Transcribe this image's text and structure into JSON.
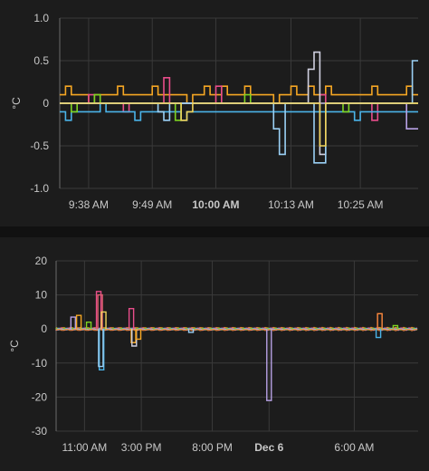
{
  "colors": {
    "background": "#1c1c1c",
    "grid": "#3a3a3a",
    "text": "#c8c8c8",
    "series": [
      "#f5a623",
      "#e84d8a",
      "#4ab3e8",
      "#7ed321",
      "#b8a2e6",
      "#ff8a3d",
      "#f0d35a",
      "#9ad0f5",
      "#d0d0e0",
      "#e06070"
    ]
  },
  "chart_data": [
    {
      "type": "line",
      "title": "",
      "xlabel": "",
      "ylabel": "°C",
      "ylim": [
        -1.0,
        1.0
      ],
      "yticks": [
        "1.0",
        "0.5",
        "0",
        "-0.5",
        "-1.0"
      ],
      "ytick_values": [
        1.0,
        0.5,
        0,
        -0.5,
        -1.0
      ],
      "xlim": [
        "9:33 AM",
        "10:35 AM"
      ],
      "xticks": [
        {
          "label": "9:38 AM",
          "t": 5,
          "bold": false
        },
        {
          "label": "9:49 AM",
          "t": 16,
          "bold": false
        },
        {
          "label": "10:00 AM",
          "t": 27,
          "bold": true
        },
        {
          "label": "10:13 AM",
          "t": 40,
          "bold": false
        },
        {
          "label": "10:25 AM",
          "t": 52,
          "bold": false
        }
      ],
      "x_span_minutes": 62,
      "grid": true,
      "series": [
        {
          "color": "#f5a623",
          "baseline": 0.1,
          "values": [
            0.1,
            0.2,
            0.1,
            0.1,
            0.1,
            0,
            0.1,
            0.1,
            0.1,
            0.1,
            0.2,
            0.1,
            0.1,
            0.1,
            0.1,
            0.1,
            0.2,
            0.1,
            0.1,
            0.1,
            0.1,
            0.1,
            0,
            0.1,
            0.1,
            0.2,
            0.1,
            0.1,
            0.2,
            0.1,
            0.1,
            0.1,
            0.2,
            0.1,
            0.1,
            0.1,
            0.1,
            0,
            0.1,
            0.1,
            0.2,
            0.1,
            0.1,
            0.2,
            0.1,
            0.1,
            0.2,
            0.1,
            0.1,
            0.1,
            0.1,
            0.1,
            0.1,
            0.1,
            0.2,
            0.1,
            0.1,
            0.1,
            0.1,
            0.1,
            0.2,
            0.1
          ]
        },
        {
          "color": "#e84d8a",
          "baseline": 0,
          "values": [
            0,
            0,
            0,
            0,
            0,
            0.1,
            0,
            0,
            0,
            0,
            0,
            -0.1,
            0,
            0,
            0,
            0,
            0,
            0,
            0.3,
            0,
            0,
            0,
            0,
            0,
            0,
            0,
            0,
            0.2,
            0,
            0,
            0,
            0,
            0,
            0,
            0,
            0,
            0,
            0,
            0,
            0,
            0,
            0,
            0,
            0,
            0,
            0.1,
            0,
            0,
            0,
            0,
            0,
            0,
            0,
            0,
            -0.2,
            0,
            0,
            0,
            0,
            0,
            0,
            0
          ]
        },
        {
          "color": "#4ab3e8",
          "baseline": -0.1,
          "values": [
            -0.1,
            -0.2,
            -0.1,
            -0.1,
            -0.1,
            -0.1,
            -0.1,
            0,
            -0.1,
            -0.1,
            -0.1,
            -0.1,
            -0.1,
            -0.2,
            -0.1,
            -0.1,
            -0.1,
            -0.1,
            -0.1,
            -0.1,
            -0.1,
            -0.2,
            -0.1,
            -0.1,
            -0.1,
            -0.1,
            -0.1,
            -0.1,
            -0.1,
            -0.1,
            -0.1,
            -0.1,
            -0.1,
            -0.1,
            -0.1,
            -0.1,
            -0.1,
            -0.1,
            -0.1,
            -0.1,
            -0.1,
            -0.1,
            -0.1,
            -0.1,
            -0.1,
            -0.1,
            -0.1,
            -0.1,
            -0.1,
            -0.1,
            -0.1,
            -0.2,
            -0.1,
            -0.1,
            -0.1,
            -0.1,
            -0.1,
            -0.1,
            -0.1,
            -0.1,
            -0.1,
            -0.1
          ]
        },
        {
          "color": "#7ed321",
          "baseline": 0,
          "values": [
            0,
            0,
            -0.1,
            0,
            0,
            0,
            0.1,
            0,
            0,
            0,
            0,
            0,
            0,
            0,
            0,
            0,
            0,
            0,
            0,
            0,
            -0.2,
            0,
            0,
            0,
            0,
            0,
            0,
            0,
            0,
            0,
            0,
            0,
            0.1,
            0,
            0,
            0,
            0,
            0,
            0,
            0,
            0,
            0,
            0,
            0,
            0,
            0,
            0,
            0,
            0,
            -0.1,
            0,
            0,
            0,
            0,
            0,
            0,
            0,
            0,
            0,
            0,
            0,
            0
          ]
        },
        {
          "color": "#d0d0e0",
          "baseline": 0,
          "values": [
            0,
            0,
            0,
            0,
            0,
            0,
            0,
            0,
            0,
            0,
            0,
            0,
            0,
            0,
            0,
            0,
            0,
            0,
            0,
            0,
            0,
            0,
            0,
            0,
            0,
            0,
            0,
            0,
            0,
            0,
            0,
            0,
            0,
            0,
            0,
            0,
            0,
            0,
            0,
            0,
            0,
            0,
            0,
            0.4,
            0.6,
            -0.6,
            0,
            0,
            0,
            0,
            0,
            0,
            0,
            0,
            0,
            0,
            0,
            0,
            0,
            0,
            0,
            0
          ]
        },
        {
          "color": "#b8a2e6",
          "baseline": 0,
          "values": [
            0,
            0,
            0,
            0,
            0,
            0,
            0,
            0,
            0,
            0,
            0,
            0,
            0,
            0,
            0,
            0,
            0,
            0,
            0,
            0,
            0,
            0,
            0,
            0,
            0,
            0,
            0,
            0,
            0,
            0,
            0,
            0,
            0,
            0,
            0,
            0,
            0,
            0,
            0,
            0,
            0,
            0,
            0,
            0,
            0,
            0,
            0,
            0,
            0,
            0,
            0,
            0,
            0,
            0,
            0,
            0,
            0,
            0,
            0,
            0,
            -0.3,
            -0.3
          ]
        },
        {
          "color": "#9ad0f5",
          "baseline": 0,
          "values": [
            0,
            0,
            0,
            0,
            0,
            0,
            0,
            0,
            0,
            0,
            0,
            0,
            0,
            0,
            0,
            0,
            0,
            -0.1,
            -0.2,
            0,
            0,
            0,
            0,
            0,
            0,
            0,
            0,
            0,
            0,
            0,
            0,
            0,
            0,
            0,
            0,
            0,
            0,
            -0.3,
            -0.6,
            0,
            0,
            0,
            0,
            0,
            -0.7,
            -0.7,
            0,
            0,
            0,
            0,
            0,
            0,
            0,
            0,
            0,
            0,
            0,
            0,
            0,
            0,
            0,
            0.5
          ]
        },
        {
          "color": "#f0d35a",
          "baseline": 0,
          "values": [
            0,
            0,
            0,
            0,
            0,
            0,
            0,
            0,
            0,
            0,
            0,
            0,
            0,
            0,
            0,
            0,
            0,
            0,
            0,
            0,
            0,
            -0.2,
            -0.1,
            0,
            0,
            0,
            0,
            0,
            0,
            0,
            0,
            0,
            0,
            0,
            0,
            0,
            0,
            0,
            0,
            0,
            0,
            0,
            0,
            0,
            0,
            -0.5,
            0,
            0,
            0,
            0,
            0,
            0,
            0,
            0,
            0,
            0,
            0,
            0,
            0,
            0,
            0,
            0
          ]
        }
      ]
    },
    {
      "type": "line",
      "title": "",
      "xlabel": "",
      "ylabel": "°C",
      "ylim": [
        -30,
        20
      ],
      "yticks": [
        "20",
        "10",
        "0",
        "-10",
        "-20",
        "-30"
      ],
      "ytick_values": [
        20,
        10,
        0,
        -10,
        -20,
        -30
      ],
      "xlim": [
        "9:00 AM",
        "10:30 AM"
      ],
      "xticks": [
        {
          "label": "11:00 AM",
          "t": 2,
          "bold": false
        },
        {
          "label": "3:00 PM",
          "t": 6,
          "bold": false
        },
        {
          "label": "8:00 PM",
          "t": 11,
          "bold": false
        },
        {
          "label": "Dec 6",
          "t": 15,
          "bold": true
        },
        {
          "label": "6:00 AM",
          "t": 21,
          "bold": false
        }
      ],
      "x_span_hours": 25.5,
      "grid": true,
      "spikes": [
        {
          "t": 1.2,
          "color": "#b8a2e6",
          "value": 3.5
        },
        {
          "t": 1.6,
          "color": "#f5a623",
          "value": 4
        },
        {
          "t": 2.3,
          "color": "#7ed321",
          "value": 2
        },
        {
          "t": 3.0,
          "color": "#e84d8a",
          "value": 11
        },
        {
          "t": 3.1,
          "color": "#e06070",
          "value": 10
        },
        {
          "t": 3.2,
          "color": "#4ab3e8",
          "value": -12
        },
        {
          "t": 3.15,
          "color": "#9ad0f5",
          "value": -11
        },
        {
          "t": 3.35,
          "color": "#f0d35a",
          "value": 5
        },
        {
          "t": 5.3,
          "color": "#e84d8a",
          "value": 6
        },
        {
          "t": 5.45,
          "color": "#f5a623",
          "value": -4
        },
        {
          "t": 5.5,
          "color": "#d0d0e0",
          "value": -5
        },
        {
          "t": 5.8,
          "color": "#f5a623",
          "value": -3
        },
        {
          "t": 9.5,
          "color": "#9ad0f5",
          "value": -1
        },
        {
          "t": 15.0,
          "color": "#b8a2e6",
          "value": -21
        },
        {
          "t": 22.8,
          "color": "#ff8a3d",
          "value": 4.5
        },
        {
          "t": 22.7,
          "color": "#4ab3e8",
          "value": -2.5
        },
        {
          "t": 23.9,
          "color": "#7ed321",
          "value": 1
        }
      ]
    }
  ]
}
